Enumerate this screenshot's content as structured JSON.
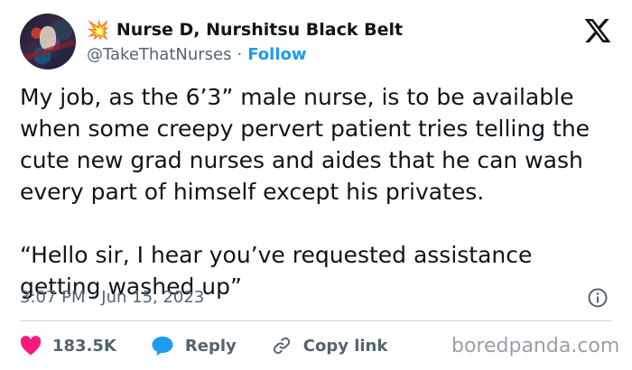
{
  "author": {
    "emoji": "💥",
    "display_name": "Nurse D, Nurshitsu Black Belt",
    "handle": "@TakeThatNurses",
    "separator": "·",
    "follow_label": "Follow",
    "avatar_icon": "profile-avatar"
  },
  "tweet": {
    "text": "My job, as the 6’3” male nurse, is to be available\nwhen some creepy pervert patient tries telling the\ncute new grad nurses and aides that he can wash\nevery part of himself except his privates.\n\n“Hello sir, I hear you’ve requested assistance\ngetting washed up”"
  },
  "meta": {
    "time": "3:07 PM",
    "separator": "·",
    "date": "Jun 15, 2023"
  },
  "actions": {
    "likes": "183.5K",
    "reply_label": "Reply",
    "copy_link_label": "Copy link"
  },
  "watermark": "boredpanda.com",
  "colors": {
    "like": "#f91880",
    "reply": "#1d9bf0",
    "follow": "#1d9bf0",
    "muted": "#536471"
  },
  "icons": {
    "platform": "x-logo-icon",
    "info": "info-icon",
    "like": "heart-icon",
    "reply": "speech-bubble-icon",
    "copy_link": "link-icon"
  }
}
